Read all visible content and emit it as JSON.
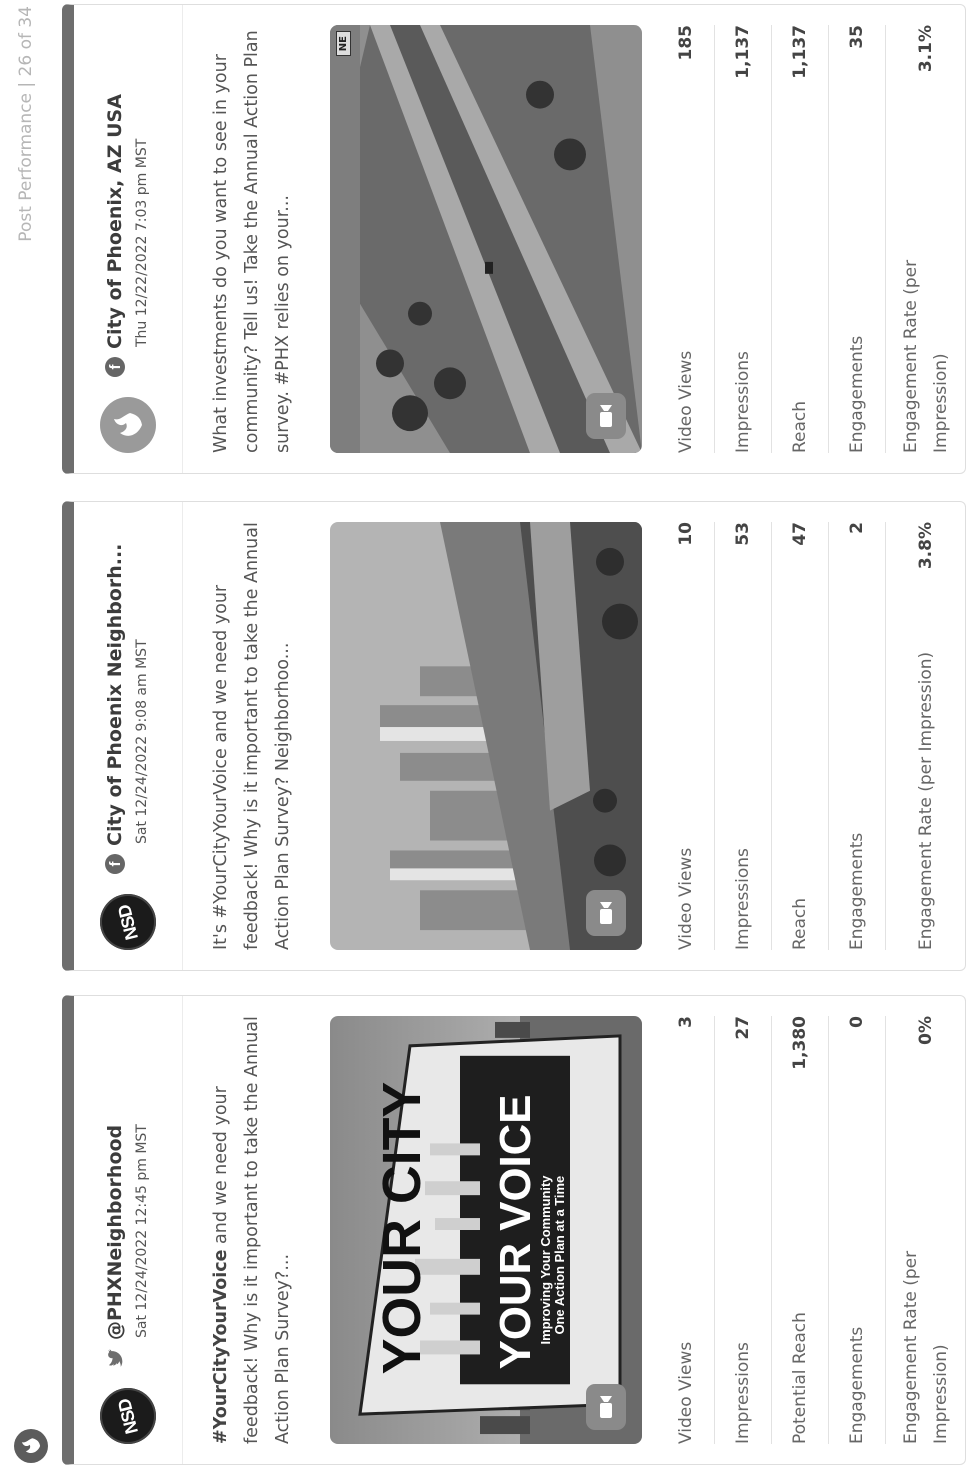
{
  "page": {
    "label": "Post Performance | 26 of 34"
  },
  "colors": {
    "card_top_border": "#6e6e6e",
    "label_text": "#666666",
    "value_text": "#444444"
  },
  "cards": [
    {
      "account": "@PHXNeighborhood",
      "network": "twitter-icon",
      "date": "Sat 12/24/2022 12:45 pm MST",
      "avatar_text": "NSD",
      "text_hashtag": "#YourCityYourVoice",
      "text_rest": " and we need your feedback! Why is it important to take the Annual Action Plan Survey?...",
      "media": {
        "type": "video",
        "graphic_top": "YOUR CITY",
        "graphic_bottom": "YOUR VOICE",
        "graphic_sub1": "Improving Your Community",
        "graphic_sub2": "One Action Plan at a Time"
      },
      "metrics": [
        {
          "label": "Video Views",
          "value": "3"
        },
        {
          "label": "Impressions",
          "value": "27"
        },
        {
          "label": "Potential Reach",
          "value": "1,380"
        },
        {
          "label": "Engagements",
          "value": "0"
        },
        {
          "label": "Engagement Rate (per Impression)",
          "value": "0%"
        }
      ]
    },
    {
      "account": "City of Phoenix Neighborh...",
      "network": "facebook-icon",
      "date": "Sat 12/24/2022 9:08 am MST",
      "avatar_text": "NSD",
      "text": "It's #YourCityYourVoice and we need your feedback! Why is it important to take the Annual Action Plan Survey? Neighborhoo...",
      "media": {
        "type": "video"
      },
      "metrics": [
        {
          "label": "Video Views",
          "value": "10"
        },
        {
          "label": "Impressions",
          "value": "53"
        },
        {
          "label": "Reach",
          "value": "47"
        },
        {
          "label": "Engagements",
          "value": "2"
        },
        {
          "label": "Engagement Rate (per Impression)",
          "value": "3.8%"
        }
      ]
    },
    {
      "account": "City of Phoenix, AZ USA",
      "network": "facebook-icon",
      "date": "Thu 12/22/2022 7:03 pm MST",
      "text": "What investments do you want to see in your community? Tell us! Take the Annual Action Plan survey. #PHX relies on your...",
      "media": {
        "type": "video",
        "tag": "NE"
      },
      "metrics": [
        {
          "label": "Video Views",
          "value": "185"
        },
        {
          "label": "Impressions",
          "value": "1,137"
        },
        {
          "label": "Reach",
          "value": "1,137"
        },
        {
          "label": "Engagements",
          "value": "35"
        },
        {
          "label": "Engagement Rate (per Impression)",
          "value": "3.1%"
        }
      ]
    }
  ]
}
